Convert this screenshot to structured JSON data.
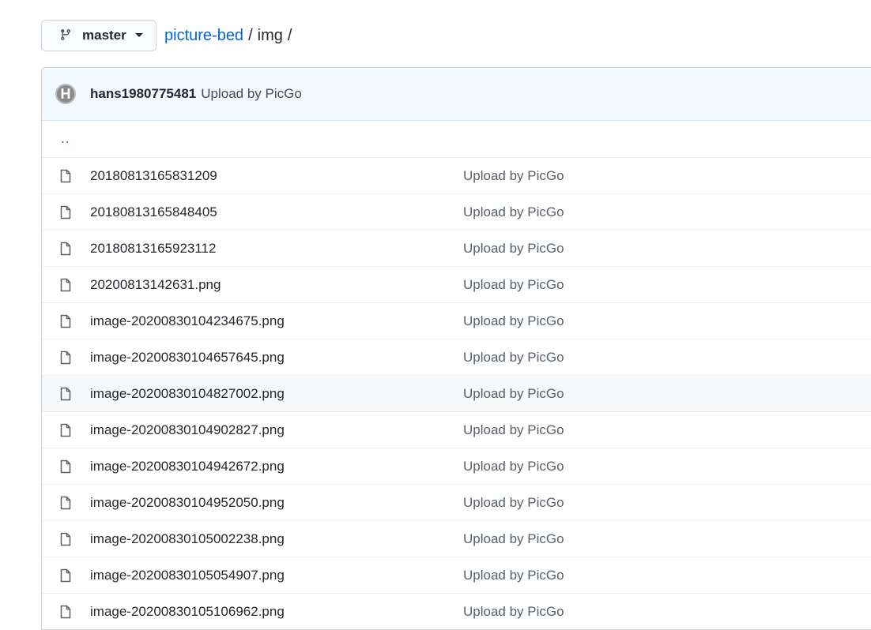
{
  "branch": {
    "name": "master"
  },
  "breadcrumb": {
    "repo": "picture-bed",
    "sep1": "/",
    "dir": "img",
    "sep2": "/"
  },
  "commit": {
    "avatar_letter": "H",
    "author": "hans1980775481",
    "message": "Upload by PicGo"
  },
  "parent_dir": "..",
  "files": [
    {
      "name": "20180813165831209",
      "message": "Upload by PicGo"
    },
    {
      "name": "20180813165848405",
      "message": "Upload by PicGo"
    },
    {
      "name": "20180813165923112",
      "message": "Upload by PicGo"
    },
    {
      "name": "20200813142631.png",
      "message": "Upload by PicGo"
    },
    {
      "name": "image-20200830104234675.png",
      "message": "Upload by PicGo"
    },
    {
      "name": "image-20200830104657645.png",
      "message": "Upload by PicGo"
    },
    {
      "name": "image-20200830104827002.png",
      "message": "Upload by PicGo"
    },
    {
      "name": "image-20200830104902827.png",
      "message": "Upload by PicGo"
    },
    {
      "name": "image-20200830104942672.png",
      "message": "Upload by PicGo"
    },
    {
      "name": "image-20200830104952050.png",
      "message": "Upload by PicGo"
    },
    {
      "name": "image-20200830105002238.png",
      "message": "Upload by PicGo"
    },
    {
      "name": "image-20200830105054907.png",
      "message": "Upload by PicGo"
    },
    {
      "name": "image-20200830105106962.png",
      "message": "Upload by PicGo"
    }
  ],
  "icons": {
    "branch": "git-branch-icon",
    "caret": "caret-down-icon",
    "file": "file-icon"
  },
  "colors": {
    "link": "#0366d6",
    "commit_bg": "#f1f8ff",
    "border": "#d1d5da"
  }
}
